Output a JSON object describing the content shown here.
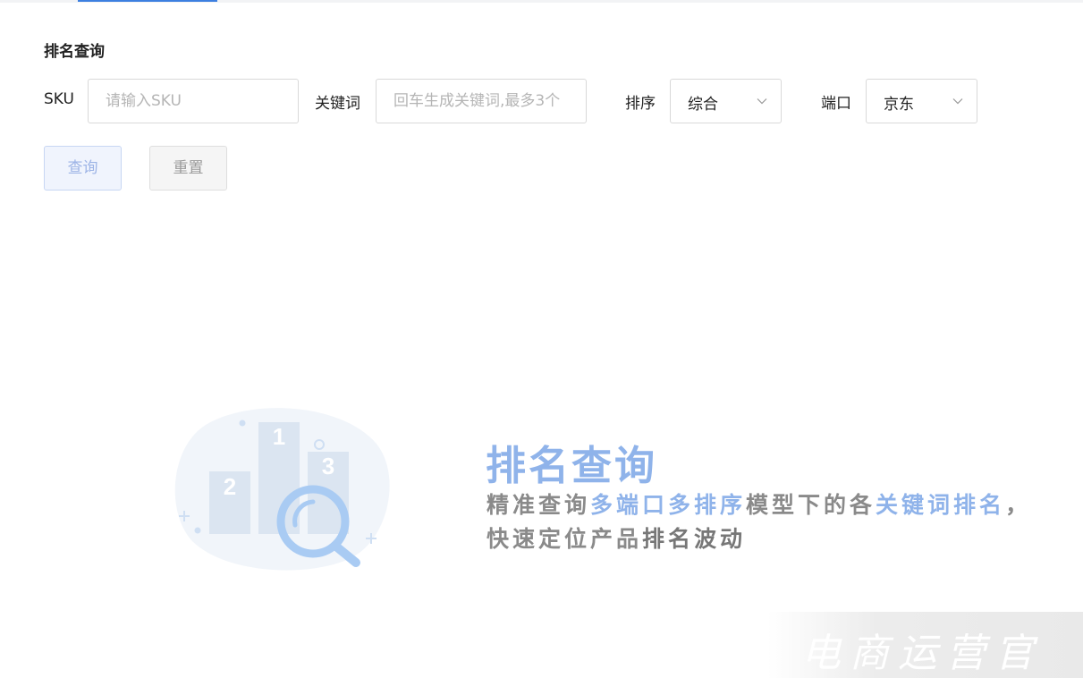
{
  "filter": {
    "section_title": "排名查询",
    "sku": {
      "label": "SKU",
      "placeholder": "请输入SKU",
      "value": ""
    },
    "keyword": {
      "label": "关键词",
      "placeholder": "回车生成关键词,最多3个",
      "value": ""
    },
    "sort": {
      "label": "排序",
      "selected": "综合"
    },
    "port": {
      "label": "端口",
      "selected": "京东"
    },
    "buttons": {
      "query": "查询",
      "reset": "重置"
    }
  },
  "empty_state": {
    "podium_numbers": [
      "1",
      "2",
      "3"
    ],
    "title": "排名查询",
    "line1": [
      {
        "text": "精准查询",
        "style": "muted"
      },
      {
        "text": "多端口多排序",
        "style": "hl"
      },
      {
        "text": "模型下的各",
        "style": "muted"
      },
      {
        "text": "关键词排名",
        "style": "hl"
      },
      {
        "text": "，",
        "style": "muted"
      }
    ],
    "line2": [
      {
        "text": "快速定位产品",
        "style": "muted"
      },
      {
        "text": "排名波动",
        "style": "strong"
      }
    ]
  },
  "watermark": {
    "text": "电商运营官"
  },
  "colors": {
    "accent": "#3d7fe0",
    "promo_highlight": "#8fb3ea",
    "border": "#d9d9d9"
  }
}
